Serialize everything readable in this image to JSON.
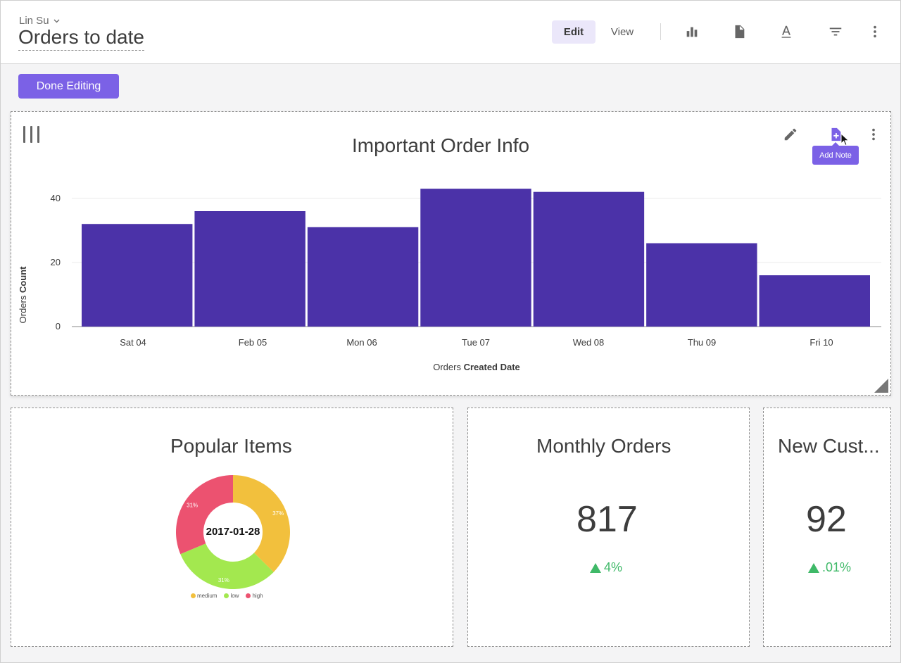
{
  "header": {
    "owner": "Lin Su",
    "title": "Orders to date",
    "mode_edit": "Edit",
    "mode_view": "View",
    "icons": [
      "bar-chart-icon",
      "document-icon",
      "text-format-icon",
      "filter-icon",
      "more-vert-icon"
    ]
  },
  "done_button": "Done Editing",
  "main_tile": {
    "title": "Important Order Info",
    "tooltip": "Add Note",
    "icons": [
      "drag-handle-icon",
      "pencil-icon",
      "add-note-icon",
      "more-vert-icon"
    ]
  },
  "chart_data": {
    "type": "bar",
    "categories": [
      "Sat 04",
      "Feb 05",
      "Mon 06",
      "Tue 07",
      "Wed 08",
      "Thu 09",
      "Fri 10"
    ],
    "values": [
      32,
      36,
      31,
      43,
      42,
      26,
      16
    ],
    "ylabel_prefix": "Orders",
    "ylabel_bold": "Count",
    "xlabel_prefix": "Orders",
    "xlabel_bold": "Created Date",
    "yticks": [
      0,
      20,
      40
    ],
    "ylim": [
      0,
      45
    ],
    "bar_color": "#4b32a8",
    "grid": true
  },
  "pie_tile": {
    "title": "Popular Items",
    "center_label": "2017-01-28",
    "slices": [
      {
        "name": "medium",
        "value": 37,
        "label": "37%",
        "color": "#f2c03d"
      },
      {
        "name": "low",
        "value": 31,
        "label": "31%",
        "color": "#a3e84f"
      },
      {
        "name": "high",
        "value": 31,
        "label": "31%",
        "color": "#ec5270"
      }
    ]
  },
  "monthly_tile": {
    "title": "Monthly Orders",
    "value": "817",
    "delta": "4%"
  },
  "newcust_tile": {
    "title": "New Cust...",
    "value": "92",
    "delta": ".01%"
  },
  "colors": {
    "accent": "#7b61e6",
    "positive": "#3fb968"
  }
}
